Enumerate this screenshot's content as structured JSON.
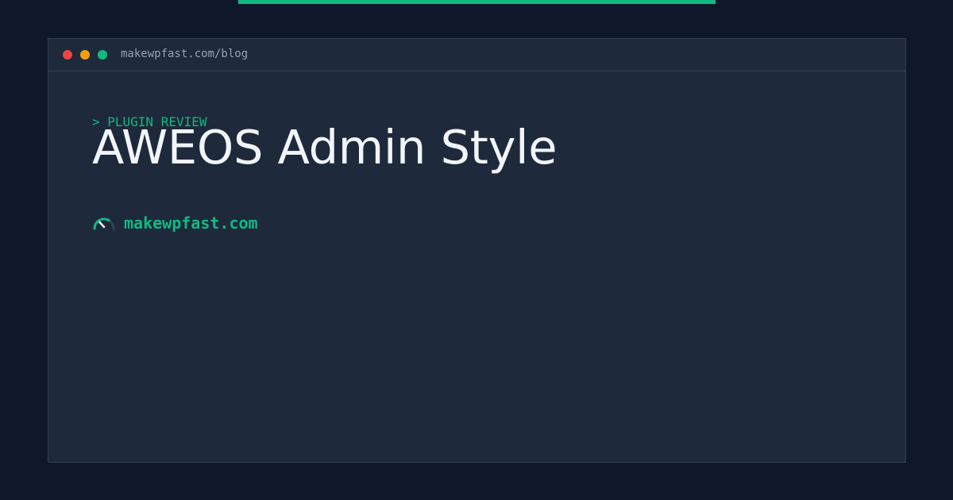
{
  "window": {
    "url": "makewpfast.com/blog",
    "controls": [
      "close",
      "minimize",
      "maximize"
    ]
  },
  "content": {
    "tag": "> PLUGIN REVIEW",
    "title": "AWEOS Admin Style"
  },
  "brand": {
    "icon": "speedometer-icon",
    "name": "makewpfast.com"
  },
  "colors": {
    "background": "#0f172a",
    "panel": "#1e293b",
    "border": "#334155",
    "accent": "#10b981",
    "close": "#ef4444",
    "minimize": "#f59e0b",
    "maximize": "#10b981",
    "title_text": "#f1f5f9",
    "muted_text": "#94a3b8"
  }
}
